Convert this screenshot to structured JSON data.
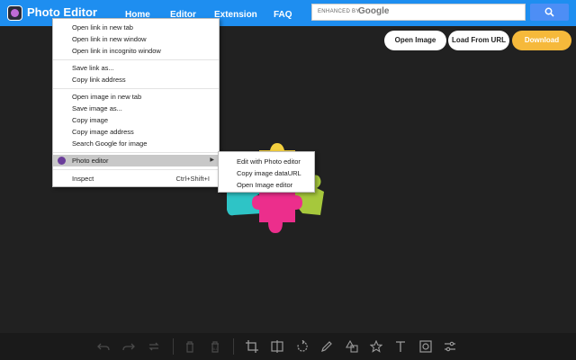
{
  "header": {
    "app_title": "Photo Editor",
    "nav": [
      "Home",
      "Editor",
      "Extension",
      "FAQ"
    ],
    "search": {
      "enhanced_by": "ENHANCED BY",
      "brand": "Google"
    }
  },
  "actions": {
    "open_image": "Open Image",
    "load_from_url": "Load From URL",
    "download": "Download"
  },
  "context_menu": {
    "items": [
      "Open link in new tab",
      "Open link in new window",
      "Open link in incognito window",
      "Save link as...",
      "Copy link address",
      "Open image in new tab",
      "Save image as...",
      "Copy image",
      "Copy image address",
      "Search Google for image",
      "Photo editor",
      "Inspect"
    ],
    "inspect_shortcut": "Ctrl+Shift+I",
    "submenu": [
      "Edit with Photo editor",
      "Copy image dataURL",
      "Open Image editor"
    ]
  },
  "colors": {
    "topbar": "#1e8ef0",
    "download": "#f6b93b",
    "background": "#212121",
    "puzzle": [
      "#f4d03f",
      "#ec2e8c",
      "#2ec4c6",
      "#a6c83c"
    ]
  },
  "toolbar_icons": [
    "undo-icon",
    "redo-icon",
    "refresh-icon",
    "delete-icon",
    "delete-all-icon",
    "crop-icon",
    "flip-icon",
    "rotate-icon",
    "draw-icon",
    "shape-icon",
    "star-icon",
    "text-icon",
    "mask-icon",
    "filter-icon"
  ],
  "toolbar_text": {
    "delete_all_label": "ALL"
  }
}
